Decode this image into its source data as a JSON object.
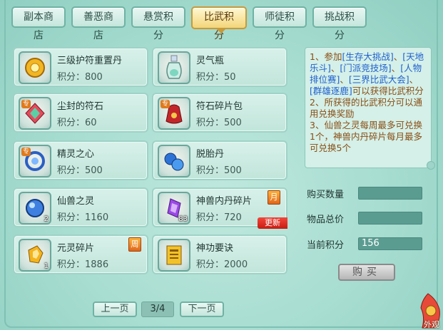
{
  "tabs": [
    {
      "label": "副本商店",
      "active": false
    },
    {
      "label": "善恶商店",
      "active": false
    },
    {
      "label": "悬赏积分",
      "active": false
    },
    {
      "label": "比武积分",
      "active": true
    },
    {
      "label": "师徒积分",
      "active": false
    },
    {
      "label": "挑战积分",
      "active": false
    }
  ],
  "items": [
    {
      "name": "三级护符重置丹",
      "price": "积分：800",
      "icon": "gold-amulet-icon",
      "tag_special": "",
      "qty": "",
      "tag_month": "",
      "tag_new": ""
    },
    {
      "name": "灵气瓶",
      "price": "积分：50",
      "icon": "spirit-bottle-icon",
      "tag_special": "",
      "qty": "",
      "tag_month": "",
      "tag_new": ""
    },
    {
      "name": "尘封的符石",
      "price": "积分：60",
      "icon": "rune-stone-icon",
      "tag_special": "专",
      "qty": "",
      "tag_month": "",
      "tag_new": ""
    },
    {
      "name": "符石碎片包",
      "price": "积分：500",
      "icon": "rune-fragment-bag-icon",
      "tag_special": "专",
      "qty": "",
      "tag_month": "",
      "tag_new": ""
    },
    {
      "name": "精灵之心",
      "price": "积分：500",
      "icon": "spirit-heart-icon",
      "tag_special": "专",
      "qty": "",
      "tag_month": "",
      "tag_new": ""
    },
    {
      "name": "脱胎丹",
      "price": "积分：500",
      "icon": "rebirth-pill-icon",
      "tag_special": "",
      "qty": "",
      "tag_month": "",
      "tag_new": ""
    },
    {
      "name": "仙兽之灵",
      "price": "积分：1160",
      "icon": "beast-spirit-orb-icon",
      "tag_special": "",
      "qty": "2",
      "tag_month": "",
      "tag_new": ""
    },
    {
      "name": "神兽内丹碎片",
      "price": "积分：720",
      "icon": "beast-core-crystal-icon",
      "tag_special": "",
      "qty": "83",
      "tag_month": "月",
      "tag_new": "更新"
    },
    {
      "name": "元灵碎片",
      "price": "积分：1886",
      "icon": "yuanling-shard-icon",
      "tag_special": "",
      "qty": "1",
      "tag_month": "周",
      "tag_new": ""
    },
    {
      "name": "神功要诀",
      "price": "积分：2000",
      "icon": "skill-manual-icon",
      "tag_special": "",
      "qty": "",
      "tag_month": "",
      "tag_new": ""
    }
  ],
  "info": {
    "l1a": "1、参加",
    "l1b": "[生存大挑战]",
    "l1c": "、",
    "l1d": "[天地乐斗]",
    "l1e": "、",
    "l1f": "[门派竞技场]",
    "l1g": "、",
    "l1h": "[人物排位赛]",
    "l1i": "、",
    "l1j": "[三界比武大会]",
    "l1k": "、",
    "l1l": "[群雄逐鹿]",
    "l1m": "可以获得比武积分",
    "l2": "2、所获得的比武积分可以通用兑换奖励",
    "l3": "3、仙兽之灵每周最多可兑换1个，神兽内丹碎片每月最多可兑换5个"
  },
  "form": {
    "qty_label": "购买数量",
    "qty_value": "",
    "total_label": "物品总价",
    "total_value": "",
    "points_label": "当前积分",
    "points_value": "156",
    "buy_label": "购买"
  },
  "pager": {
    "prev": "上一页",
    "page": "3/4",
    "next": "下一页"
  },
  "corner": {
    "text": "外观"
  }
}
